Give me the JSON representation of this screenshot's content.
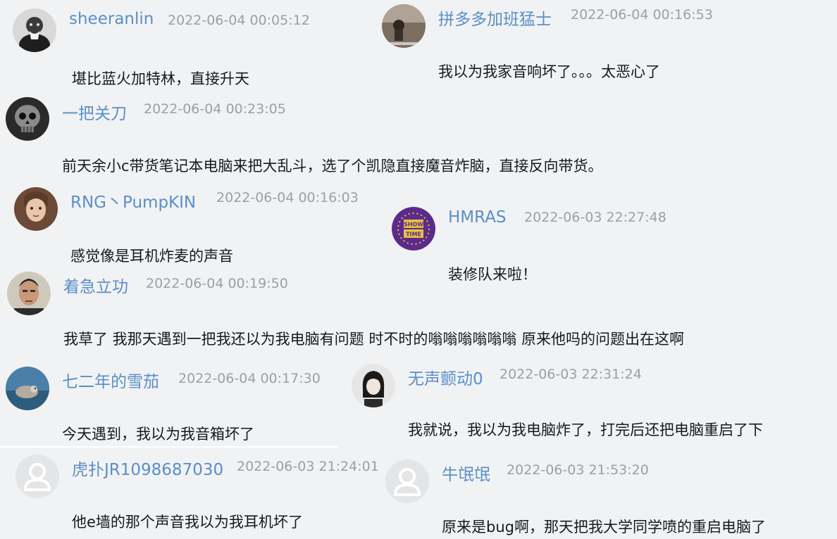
{
  "comments": [
    {
      "user": "sheeranlin",
      "time": "2022-06-04 00:05:12",
      "text": "堪比蓝火加特林，直接升天"
    },
    {
      "user": "拼多多加班猛士",
      "time": "2022-06-04 00:16:53",
      "text": "我以为我家音响坏了。。。太恶心了"
    },
    {
      "user": "一把关刀",
      "time": "2022-06-04 00:23:05",
      "text": "前天余小c带货笔记本电脑来把大乱斗，选了个凯隐直接魔音炸脑，直接反向带货。"
    },
    {
      "user": "RNG丶PumpKIN",
      "time": "2022-06-04 00:16:03",
      "text": "感觉像是耳机炸麦的声音"
    },
    {
      "user": "HMRAS",
      "time": "2022-06-03 22:27:48",
      "text": "装修队来啦！",
      "avatar_text": [
        "SHOW",
        "TIME"
      ]
    },
    {
      "user": "着急立功",
      "time": "2022-06-04 00:19:50",
      "text": "我草了 我那天遇到一把我还以为我电脑有问题 时不时的嗡嗡嗡嗡嗡嗡   原来他吗的问题出在这啊"
    },
    {
      "user": "七二年的雪茄",
      "time": "2022-06-04 00:17:30",
      "text": "今天遇到，我以为我音箱坏了"
    },
    {
      "user": "无声颤动0",
      "time": "2022-06-03 22:31:24",
      "text": "我就说，我以为我电脑炸了，打完后还把电脑重启了下"
    },
    {
      "user": "虎扑JR1098687030",
      "time": "2022-06-03 21:24:01",
      "text": "他e墙的那个声音我以为我耳机坏了"
    },
    {
      "user": "牛氓氓",
      "time": "2022-06-03 21:53:20",
      "text": "原来是bug啊，那天把我大学同学喷的重启电脑了"
    }
  ],
  "colors": {
    "background": "#f1f2f3",
    "username": "#5a8fc7",
    "timestamp": "#9aa0a6",
    "text": "#18191c"
  }
}
